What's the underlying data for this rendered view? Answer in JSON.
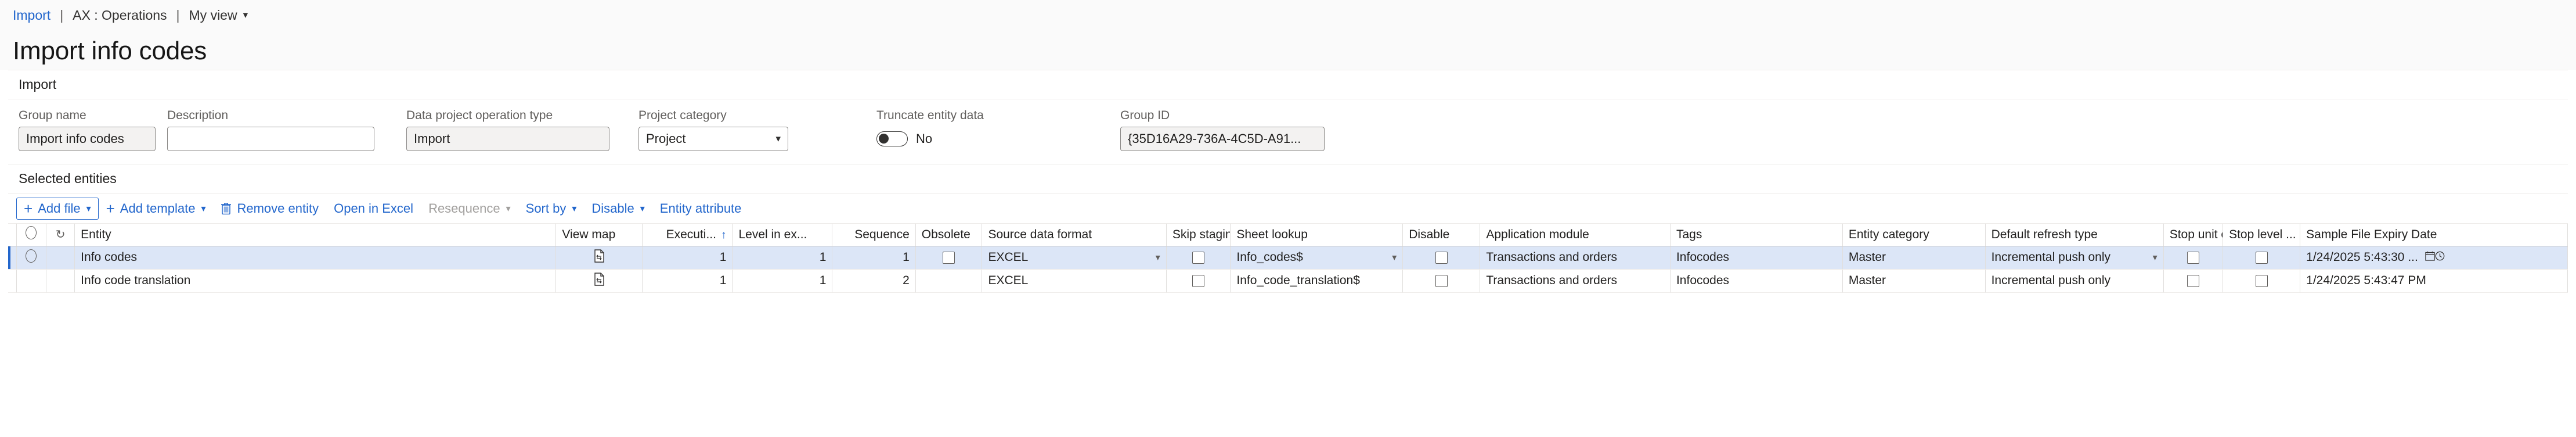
{
  "breadcrumb": {
    "link": "Import",
    "sep": "|",
    "module": "AX : Operations",
    "view": "My view",
    "chevron": "chevron-down"
  },
  "page_title": "Import info codes",
  "import_section": {
    "title": "Import",
    "fields": {
      "group_name": {
        "label": "Group name",
        "value": "Import info codes"
      },
      "description": {
        "label": "Description",
        "value": ""
      },
      "operation_type": {
        "label": "Data project operation type",
        "value": "Import"
      },
      "project_category": {
        "label": "Project category",
        "value": "Project"
      },
      "truncate": {
        "label": "Truncate entity data",
        "value": "No",
        "state": "off"
      },
      "group_id": {
        "label": "Group ID",
        "value": "{35D16A29-736A-4C5D-A91..."
      }
    }
  },
  "entities_section": {
    "title": "Selected entities",
    "toolbar": [
      {
        "label": "Add file",
        "icon": "plus-icon",
        "chevron": true,
        "primary": true,
        "disabled": false
      },
      {
        "label": "Add template",
        "icon": "plus-icon",
        "chevron": true,
        "primary": false,
        "disabled": false
      },
      {
        "label": "Remove entity",
        "icon": "trash-icon",
        "chevron": false,
        "primary": false,
        "disabled": false
      },
      {
        "label": "Open in Excel",
        "icon": "",
        "chevron": false,
        "primary": false,
        "disabled": false
      },
      {
        "label": "Resequence",
        "icon": "",
        "chevron": true,
        "primary": false,
        "disabled": true
      },
      {
        "label": "Sort by",
        "icon": "",
        "chevron": true,
        "primary": false,
        "disabled": false
      },
      {
        "label": "Disable",
        "icon": "",
        "chevron": true,
        "primary": false,
        "disabled": false
      },
      {
        "label": "Entity attribute",
        "icon": "",
        "chevron": false,
        "primary": false,
        "disabled": false
      }
    ],
    "columns": [
      {
        "key": "marker",
        "label": "",
        "align": "c"
      },
      {
        "key": "select",
        "label": "",
        "align": "c"
      },
      {
        "key": "refresh",
        "label": "",
        "align": "c"
      },
      {
        "key": "entity",
        "label": "Entity",
        "align": "l"
      },
      {
        "key": "view_map",
        "label": "View map",
        "align": "l"
      },
      {
        "key": "execution",
        "label": "Executi...",
        "align": "num",
        "sorted": "asc"
      },
      {
        "key": "level",
        "label": "Level in ex...",
        "align": "num"
      },
      {
        "key": "sequence",
        "label": "Sequence",
        "align": "num"
      },
      {
        "key": "obsolete",
        "label": "Obsolete",
        "align": "l"
      },
      {
        "key": "source_format",
        "label": "Source data format",
        "align": "l"
      },
      {
        "key": "skip_staging",
        "label": "Skip staging",
        "align": "l"
      },
      {
        "key": "sheet_lookup",
        "label": "Sheet lookup",
        "align": "l"
      },
      {
        "key": "disable",
        "label": "Disable",
        "align": "l"
      },
      {
        "key": "app_module",
        "label": "Application module",
        "align": "l"
      },
      {
        "key": "tags",
        "label": "Tags",
        "align": "l"
      },
      {
        "key": "entity_category",
        "label": "Entity category",
        "align": "l"
      },
      {
        "key": "refresh_type",
        "label": "Default refresh type",
        "align": "l"
      },
      {
        "key": "stop_unit",
        "label": "Stop unit e...",
        "align": "l"
      },
      {
        "key": "stop_level",
        "label": "Stop level ...",
        "align": "l"
      },
      {
        "key": "expiry",
        "label": "Sample File Expiry Date",
        "align": "l"
      }
    ],
    "rows": [
      {
        "selected": true,
        "entity": "Info codes",
        "view_map": "document-icon",
        "execution": "1",
        "level": "1",
        "sequence": "1",
        "obsolete": "unchecked",
        "source_format": "EXCEL",
        "source_format_combo": true,
        "skip_staging": "unchecked",
        "sheet_lookup": "Info_codes$",
        "sheet_lookup_combo": true,
        "disable": "unchecked",
        "app_module": "Transactions and orders",
        "tags": "Infocodes",
        "entity_category": "Master",
        "refresh_type": "Incremental push only",
        "refresh_type_combo": true,
        "stop_unit": "unchecked",
        "stop_level": "unchecked",
        "expiry": "1/24/2025 5:43:30 ...",
        "expiry_icons": "calendar-icon clock-icon"
      },
      {
        "selected": false,
        "entity": "Info code translation",
        "view_map": "document-icon",
        "execution": "1",
        "level": "1",
        "sequence": "2",
        "obsolete": "",
        "source_format": "EXCEL",
        "source_format_combo": false,
        "skip_staging": "unchecked",
        "sheet_lookup": "Info_code_translation$",
        "sheet_lookup_combo": false,
        "disable": "unchecked",
        "app_module": "Transactions and orders",
        "tags": "Infocodes",
        "entity_category": "Master",
        "refresh_type": "Incremental push only",
        "refresh_type_combo": false,
        "stop_unit": "unchecked",
        "stop_level": "unchecked",
        "expiry": "1/24/2025 5:43:47 PM",
        "expiry_icons": ""
      }
    ]
  },
  "colors": {
    "accent": "#2266cc",
    "selected_row": "#dce6f7",
    "header_bg": "#fafafa",
    "border": "#e1dfdd"
  }
}
